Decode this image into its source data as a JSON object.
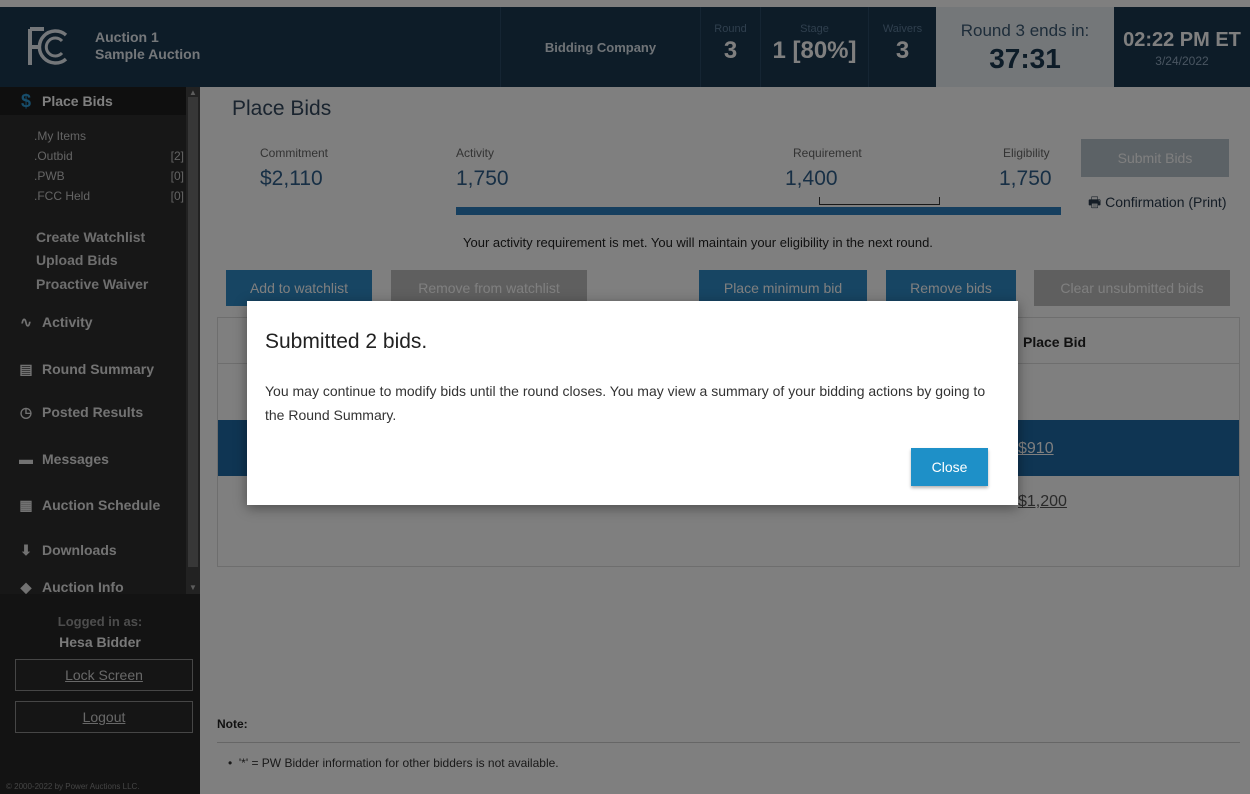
{
  "header": {
    "auction_line1": "Auction 1",
    "auction_line2": "Sample Auction",
    "company": "Bidding Company",
    "round_label": "Round",
    "round_value": "3",
    "stage_label": "Stage",
    "stage_value": "1 [80%]",
    "waivers_label": "Waivers",
    "waivers_value": "3",
    "timer_label": "Round 3 ends in:",
    "timer_value": "37:31",
    "clock_time": "02:22 PM ET",
    "clock_date": "3/24/2022"
  },
  "sidebar": {
    "place_bids": "Place Bids",
    "sub_items": [
      {
        "label": ".My Items",
        "count": ""
      },
      {
        "label": ".Outbid",
        "count": "[2]"
      },
      {
        "label": ".PWB",
        "count": "[0]"
      },
      {
        "label": ".FCC Held",
        "count": "[0]"
      }
    ],
    "create_watchlist": "Create Watchlist",
    "upload_bids": "Upload Bids",
    "proactive_waiver": "Proactive Waiver",
    "activity": "Activity",
    "round_summary": "Round Summary",
    "posted_results": "Posted Results",
    "messages": "Messages",
    "auction_schedule": "Auction Schedule",
    "downloads": "Downloads",
    "auction_info": "Auction Info",
    "logged_in_as": "Logged in as:",
    "user": "Hesa Bidder",
    "lock_screen": "Lock Screen",
    "logout": "Logout",
    "copyright": "© 2000-2022 by Power Auctions LLC."
  },
  "main": {
    "title": "Place Bids",
    "commitment_label": "Commitment",
    "commitment_value": "$2,110",
    "activity_label": "Activity",
    "activity_value": "1,750",
    "requirement_label": "Requirement",
    "requirement_value": "1,400",
    "eligibility_label": "Eligibility",
    "eligibility_value": "1,750",
    "submit_bids": "Submit Bids",
    "confirmation": "Confirmation",
    "confirmation_print": "(Print)",
    "activity_message": "Your activity requirement is met. You will maintain your eligibility in the next round.",
    "toolbar": {
      "add_watchlist": "Add to watchlist",
      "remove_watchlist": "Remove from watchlist",
      "place_min_bid": "Place minimum bid",
      "remove_bids": "Remove bids",
      "clear_unsubmitted": "Clear unsubmitted bids"
    },
    "table": {
      "place_bid_header": "Place Bid",
      "row1_bid": "$910",
      "row2_bid": "$1,200"
    },
    "note_title": "Note:",
    "note_text": "'*' = PW Bidder information for other bidders is not available."
  },
  "modal": {
    "title": "Submitted 2 bids.",
    "body": "You may continue to modify bids until the round closes. You may view a summary of your bidding actions by going to the Round Summary.",
    "close": "Close"
  },
  "colors": {
    "header_navy": "#1b3851",
    "accent_blue": "#2f8ac6",
    "sidebar_dark": "#2f2f2f"
  }
}
